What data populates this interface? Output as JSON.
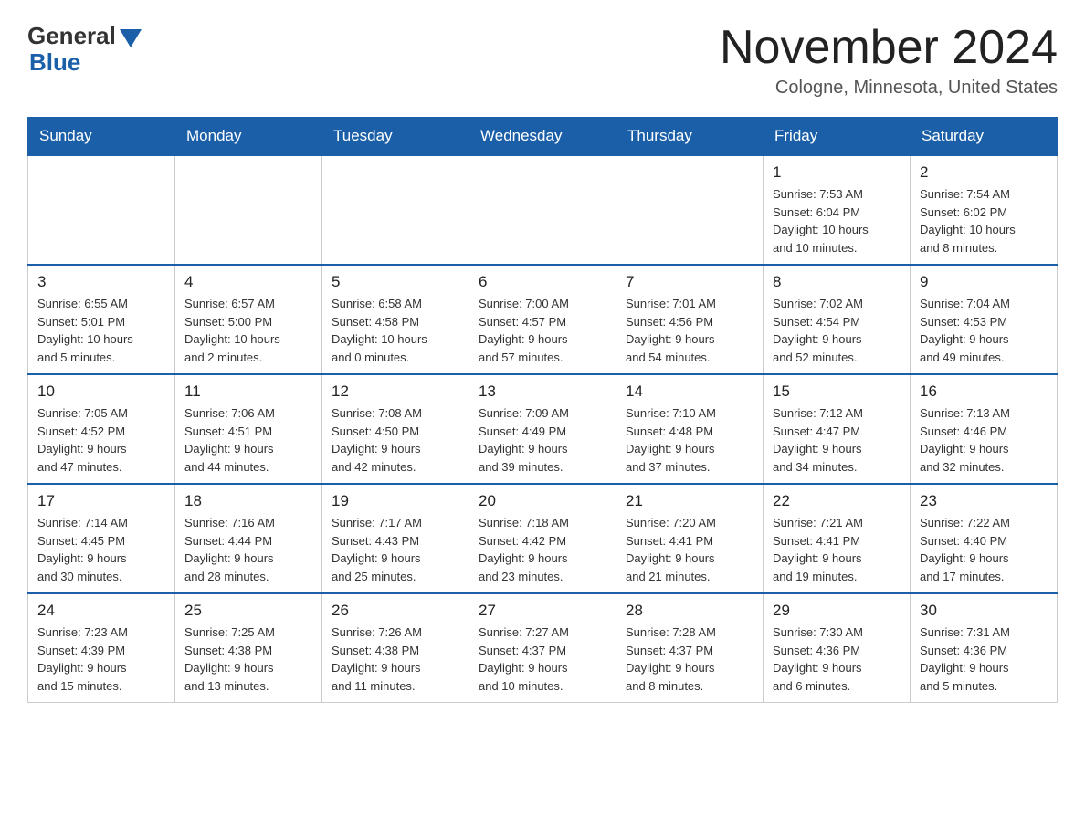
{
  "header": {
    "logo_general": "General",
    "logo_blue": "Blue",
    "month_title": "November 2024",
    "location": "Cologne, Minnesota, United States"
  },
  "calendar": {
    "days_of_week": [
      "Sunday",
      "Monday",
      "Tuesday",
      "Wednesday",
      "Thursday",
      "Friday",
      "Saturday"
    ],
    "weeks": [
      {
        "days": [
          {
            "num": "",
            "info": "",
            "empty": true
          },
          {
            "num": "",
            "info": "",
            "empty": true
          },
          {
            "num": "",
            "info": "",
            "empty": true
          },
          {
            "num": "",
            "info": "",
            "empty": true
          },
          {
            "num": "",
            "info": "",
            "empty": true
          },
          {
            "num": "1",
            "info": "Sunrise: 7:53 AM\nSunset: 6:04 PM\nDaylight: 10 hours\nand 10 minutes.",
            "empty": false
          },
          {
            "num": "2",
            "info": "Sunrise: 7:54 AM\nSunset: 6:02 PM\nDaylight: 10 hours\nand 8 minutes.",
            "empty": false
          }
        ]
      },
      {
        "days": [
          {
            "num": "3",
            "info": "Sunrise: 6:55 AM\nSunset: 5:01 PM\nDaylight: 10 hours\nand 5 minutes.",
            "empty": false
          },
          {
            "num": "4",
            "info": "Sunrise: 6:57 AM\nSunset: 5:00 PM\nDaylight: 10 hours\nand 2 minutes.",
            "empty": false
          },
          {
            "num": "5",
            "info": "Sunrise: 6:58 AM\nSunset: 4:58 PM\nDaylight: 10 hours\nand 0 minutes.",
            "empty": false
          },
          {
            "num": "6",
            "info": "Sunrise: 7:00 AM\nSunset: 4:57 PM\nDaylight: 9 hours\nand 57 minutes.",
            "empty": false
          },
          {
            "num": "7",
            "info": "Sunrise: 7:01 AM\nSunset: 4:56 PM\nDaylight: 9 hours\nand 54 minutes.",
            "empty": false
          },
          {
            "num": "8",
            "info": "Sunrise: 7:02 AM\nSunset: 4:54 PM\nDaylight: 9 hours\nand 52 minutes.",
            "empty": false
          },
          {
            "num": "9",
            "info": "Sunrise: 7:04 AM\nSunset: 4:53 PM\nDaylight: 9 hours\nand 49 minutes.",
            "empty": false
          }
        ]
      },
      {
        "days": [
          {
            "num": "10",
            "info": "Sunrise: 7:05 AM\nSunset: 4:52 PM\nDaylight: 9 hours\nand 47 minutes.",
            "empty": false
          },
          {
            "num": "11",
            "info": "Sunrise: 7:06 AM\nSunset: 4:51 PM\nDaylight: 9 hours\nand 44 minutes.",
            "empty": false
          },
          {
            "num": "12",
            "info": "Sunrise: 7:08 AM\nSunset: 4:50 PM\nDaylight: 9 hours\nand 42 minutes.",
            "empty": false
          },
          {
            "num": "13",
            "info": "Sunrise: 7:09 AM\nSunset: 4:49 PM\nDaylight: 9 hours\nand 39 minutes.",
            "empty": false
          },
          {
            "num": "14",
            "info": "Sunrise: 7:10 AM\nSunset: 4:48 PM\nDaylight: 9 hours\nand 37 minutes.",
            "empty": false
          },
          {
            "num": "15",
            "info": "Sunrise: 7:12 AM\nSunset: 4:47 PM\nDaylight: 9 hours\nand 34 minutes.",
            "empty": false
          },
          {
            "num": "16",
            "info": "Sunrise: 7:13 AM\nSunset: 4:46 PM\nDaylight: 9 hours\nand 32 minutes.",
            "empty": false
          }
        ]
      },
      {
        "days": [
          {
            "num": "17",
            "info": "Sunrise: 7:14 AM\nSunset: 4:45 PM\nDaylight: 9 hours\nand 30 minutes.",
            "empty": false
          },
          {
            "num": "18",
            "info": "Sunrise: 7:16 AM\nSunset: 4:44 PM\nDaylight: 9 hours\nand 28 minutes.",
            "empty": false
          },
          {
            "num": "19",
            "info": "Sunrise: 7:17 AM\nSunset: 4:43 PM\nDaylight: 9 hours\nand 25 minutes.",
            "empty": false
          },
          {
            "num": "20",
            "info": "Sunrise: 7:18 AM\nSunset: 4:42 PM\nDaylight: 9 hours\nand 23 minutes.",
            "empty": false
          },
          {
            "num": "21",
            "info": "Sunrise: 7:20 AM\nSunset: 4:41 PM\nDaylight: 9 hours\nand 21 minutes.",
            "empty": false
          },
          {
            "num": "22",
            "info": "Sunrise: 7:21 AM\nSunset: 4:41 PM\nDaylight: 9 hours\nand 19 minutes.",
            "empty": false
          },
          {
            "num": "23",
            "info": "Sunrise: 7:22 AM\nSunset: 4:40 PM\nDaylight: 9 hours\nand 17 minutes.",
            "empty": false
          }
        ]
      },
      {
        "days": [
          {
            "num": "24",
            "info": "Sunrise: 7:23 AM\nSunset: 4:39 PM\nDaylight: 9 hours\nand 15 minutes.",
            "empty": false
          },
          {
            "num": "25",
            "info": "Sunrise: 7:25 AM\nSunset: 4:38 PM\nDaylight: 9 hours\nand 13 minutes.",
            "empty": false
          },
          {
            "num": "26",
            "info": "Sunrise: 7:26 AM\nSunset: 4:38 PM\nDaylight: 9 hours\nand 11 minutes.",
            "empty": false
          },
          {
            "num": "27",
            "info": "Sunrise: 7:27 AM\nSunset: 4:37 PM\nDaylight: 9 hours\nand 10 minutes.",
            "empty": false
          },
          {
            "num": "28",
            "info": "Sunrise: 7:28 AM\nSunset: 4:37 PM\nDaylight: 9 hours\nand 8 minutes.",
            "empty": false
          },
          {
            "num": "29",
            "info": "Sunrise: 7:30 AM\nSunset: 4:36 PM\nDaylight: 9 hours\nand 6 minutes.",
            "empty": false
          },
          {
            "num": "30",
            "info": "Sunrise: 7:31 AM\nSunset: 4:36 PM\nDaylight: 9 hours\nand 5 minutes.",
            "empty": false
          }
        ]
      }
    ]
  }
}
